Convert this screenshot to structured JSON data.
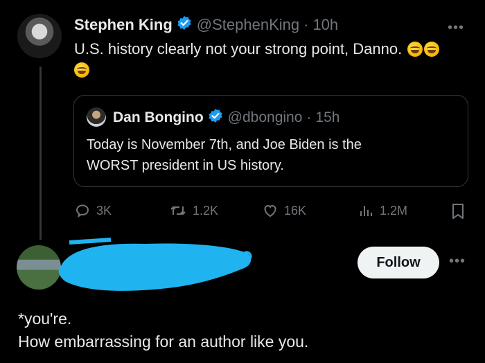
{
  "main_tweet": {
    "author_name": "Stephen King",
    "handle": "@StephenKing",
    "separator": "·",
    "time": "10h",
    "text": "U.S. history clearly not your strong point, Danno.",
    "emoji": [
      "rolling-on-floor-laughing",
      "rolling-on-floor-laughing",
      "rolling-on-floor-laughing"
    ]
  },
  "quoted_tweet": {
    "author_name": "Dan Bongino",
    "handle": "@dbongino",
    "separator": "·",
    "time": "15h",
    "text_line1": "Today is November 7th, and Joe Biden is the",
    "text_line2": "WORST president in US history."
  },
  "actions": {
    "replies": "3K",
    "retweets": "1.2K",
    "likes": "16K",
    "views": "1.2M"
  },
  "reply": {
    "follow_label": "Follow",
    "line1": "*you're.",
    "line2": "How embarrassing for an author like you."
  },
  "colors": {
    "background": "#000000",
    "text": "#e7e9ea",
    "muted": "#71767b",
    "verified": "#1d9bf0",
    "redaction": "#1fb3f0"
  },
  "icons": {
    "more": "more-icon",
    "verified": "verified-badge-icon",
    "reply": "reply-icon",
    "retweet": "retweet-icon",
    "like": "heart-icon",
    "views": "views-icon",
    "bookmark": "bookmark-icon"
  }
}
